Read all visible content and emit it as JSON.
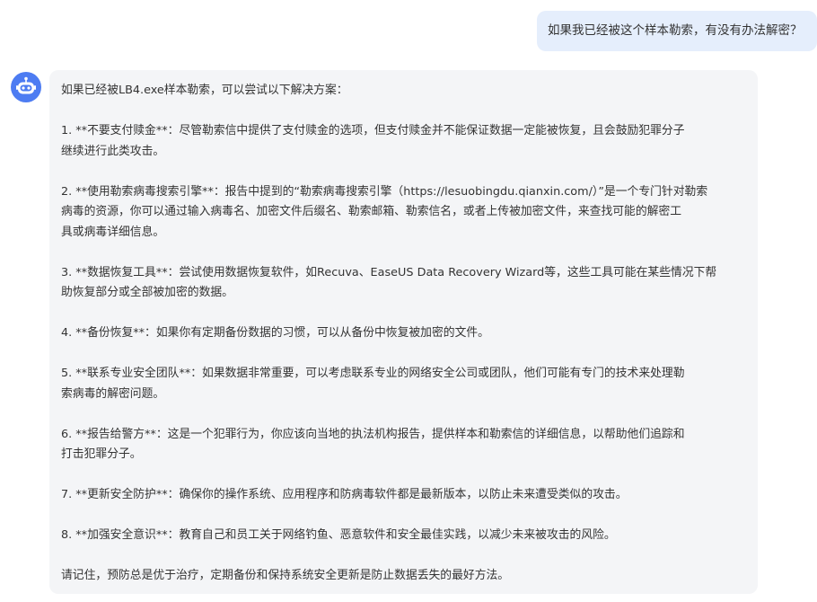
{
  "user_message": "如果我已经被这个样本勒索，有没有办法解密？",
  "assistant": {
    "avatar_icon": "robot-icon",
    "lines": {
      "intro": "如果已经被LB4.exe样本勒索，可以尝试以下解决方案：",
      "item1_l1": "1. **不要支付赎金**：尽管勒索信中提供了支付赎金的选项，但支付赎金并不能保证数据一定能被恢复，且会鼓励犯罪分子",
      "item1_l2": "继续进行此类攻击。",
      "item2_l1": "2. **使用勒索病毒搜索引擎**：报告中提到的“勒索病毒搜索引擎（https://lesuobingdu.qianxin.com/）”是一个专门针对勒索",
      "item2_l2": "病毒的资源，你可以通过输入病毒名、加密文件后缀名、勒索邮箱、勒索信名，或者上传被加密文件，来查找可能的解密工",
      "item2_l3": "具或病毒详细信息。",
      "item3_l1": "3. **数据恢复工具**：尝试使用数据恢复软件，如Recuva、EaseUS Data Recovery Wizard等，这些工具可能在某些情况下帮",
      "item3_l2": "助恢复部分或全部被加密的数据。",
      "item4_l1": "4. **备份恢复**：如果你有定期备份数据的习惯，可以从备份中恢复被加密的文件。",
      "item5_l1": "5. **联系专业安全团队**：如果数据非常重要，可以考虑联系专业的网络安全公司或团队，他们可能有专门的技术来处理勒",
      "item5_l2": "索病毒的解密问题。",
      "item6_l1": "6. **报告给警方**：这是一个犯罪行为，你应该向当地的执法机构报告，提供样本和勒索信的详细信息，以帮助他们追踪和",
      "item6_l2": "打击犯罪分子。",
      "item7_l1": "7. **更新安全防护**：确保你的操作系统、应用程序和防病毒软件都是最新版本，以防止未来遭受类似的攻击。",
      "item8_l1": "8. **加强安全意识**：教育自己和员工关于网络钓鱼、恶意软件和安全最佳实践，以减少未来被攻击的风险。",
      "outro": "请记住，预防总是优于治疗，定期备份和保持系统安全更新是防止数据丢失的最好方法。"
    }
  },
  "colors": {
    "user_bubble": "#e5eefc",
    "assistant_bubble": "#f4f5f7",
    "avatar": "#4d7cf2",
    "text": "#333333"
  }
}
